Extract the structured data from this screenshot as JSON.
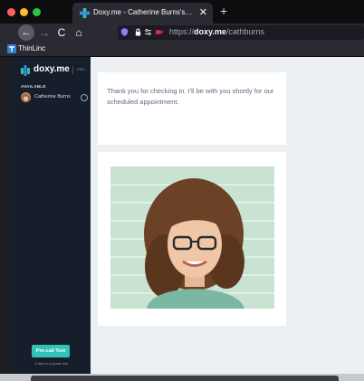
{
  "browser": {
    "tab_title": "Doxy.me - Catherine Burns's W",
    "tab_close": "✕",
    "new_tab": "+",
    "nav": {
      "back": "←",
      "forward": "→",
      "reload": "C",
      "home": "⌂"
    },
    "url": {
      "scheme": "https://",
      "host": "doxy.me",
      "path": "/cathburns"
    },
    "bookmark_label": "ThinLinc"
  },
  "sidebar": {
    "brand": "doxy.me",
    "plan": "PRO",
    "section_label": "AVAILABLE",
    "provider_name": "Catherine Burns",
    "precall_label": "Pre-call Test",
    "tips_label": "5 tips for a great call"
  },
  "main": {
    "message": "Thank you for checking in. I'll be with you shortly for our scheduled appointment."
  },
  "colors": {
    "sidebar_bg": "#151e2a",
    "accent": "#33c3b6",
    "brand_blue": "#3b8fd9",
    "message_text": "#5b6b82"
  },
  "icons": [
    "back-arrow-icon",
    "forward-arrow-icon",
    "reload-icon",
    "home-icon",
    "shield-icon",
    "lock-icon",
    "permissions-icon",
    "doxy-logo-icon",
    "camera-icon"
  ]
}
